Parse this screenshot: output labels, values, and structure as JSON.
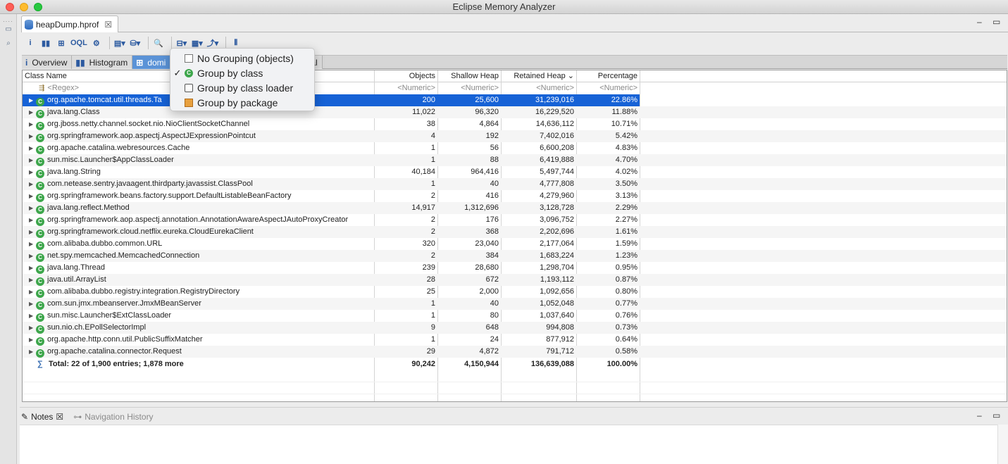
{
  "window": {
    "title": "Eclipse Memory Analyzer"
  },
  "editor_tab": {
    "label": "heapDump.hprof"
  },
  "window_controls": {
    "minimize": "–",
    "maximize": "▭"
  },
  "toolbar": {
    "buttons": [
      {
        "name": "info-icon",
        "glyph": "i"
      },
      {
        "name": "histogram-icon",
        "glyph": "▮▮"
      },
      {
        "name": "dominator-tree-icon",
        "glyph": "⊞"
      },
      {
        "name": "oql-icon",
        "glyph": "OQL"
      },
      {
        "name": "thread-overview-icon",
        "glyph": "⚙"
      },
      {
        "name": "run-report-icon",
        "glyph": "▤▾"
      },
      {
        "name": "query-browser-icon",
        "glyph": "⛁▾"
      },
      {
        "name": "search-icon",
        "glyph": "🔍"
      },
      {
        "name": "group-by-icon",
        "glyph": "⊟▾"
      },
      {
        "name": "calculator-icon",
        "glyph": "▦▾"
      },
      {
        "name": "export-icon",
        "glyph": "⤴▾"
      },
      {
        "name": "compare-icon",
        "glyph": "⫴"
      }
    ]
  },
  "subtabs": [
    {
      "label": "Overview",
      "icon": "i"
    },
    {
      "label": "Histogram",
      "icon": "▮▮"
    },
    {
      "label": "domi",
      "icon": "⊞"
    },
    {
      "label": "al",
      "icon": ""
    }
  ],
  "group_menu": {
    "items": [
      {
        "label": "No Grouping (objects)",
        "checked": "",
        "icon": "file"
      },
      {
        "label": "Group by class",
        "checked": "✓",
        "icon": "class"
      },
      {
        "label": "Group by class loader",
        "checked": "",
        "icon": "loader"
      },
      {
        "label": "Group by package",
        "checked": "",
        "icon": "package"
      }
    ]
  },
  "table": {
    "columns": [
      "Class Name",
      "Objects",
      "Shallow Heap",
      "Retained Heap",
      "Percentage"
    ],
    "sort_indicator": "⌄",
    "filter": {
      "name": "<Regex>",
      "objects": "<Numeric>",
      "shallow": "<Numeric>",
      "retained": "<Numeric>",
      "percentage": "<Numeric>"
    },
    "rows": [
      {
        "name": "org.apache.tomcat.util.threads.Ta",
        "objects": "200",
        "shallow": "25,600",
        "retained": "31,239,016",
        "percentage": "22.86%"
      },
      {
        "name": "java.lang.Class",
        "objects": "11,022",
        "shallow": "96,320",
        "retained": "16,229,520",
        "percentage": "11.88%"
      },
      {
        "name": "org.jboss.netty.channel.socket.nio.NioClientSocketChannel",
        "objects": "38",
        "shallow": "4,864",
        "retained": "14,636,112",
        "percentage": "10.71%"
      },
      {
        "name": "org.springframework.aop.aspectj.AspectJExpressionPointcut",
        "objects": "4",
        "shallow": "192",
        "retained": "7,402,016",
        "percentage": "5.42%"
      },
      {
        "name": "org.apache.catalina.webresources.Cache",
        "objects": "1",
        "shallow": "56",
        "retained": "6,600,208",
        "percentage": "4.83%"
      },
      {
        "name": "sun.misc.Launcher$AppClassLoader",
        "objects": "1",
        "shallow": "88",
        "retained": "6,419,888",
        "percentage": "4.70%"
      },
      {
        "name": "java.lang.String",
        "objects": "40,184",
        "shallow": "964,416",
        "retained": "5,497,744",
        "percentage": "4.02%"
      },
      {
        "name": "com.netease.sentry.javaagent.thirdparty.javassist.ClassPool",
        "objects": "1",
        "shallow": "40",
        "retained": "4,777,808",
        "percentage": "3.50%"
      },
      {
        "name": "org.springframework.beans.factory.support.DefaultListableBeanFactory",
        "objects": "2",
        "shallow": "416",
        "retained": "4,279,960",
        "percentage": "3.13%"
      },
      {
        "name": "java.lang.reflect.Method",
        "objects": "14,917",
        "shallow": "1,312,696",
        "retained": "3,128,728",
        "percentage": "2.29%"
      },
      {
        "name": "org.springframework.aop.aspectj.annotation.AnnotationAwareAspectJAutoProxyCreator",
        "objects": "2",
        "shallow": "176",
        "retained": "3,096,752",
        "percentage": "2.27%"
      },
      {
        "name": "org.springframework.cloud.netflix.eureka.CloudEurekaClient",
        "objects": "2",
        "shallow": "368",
        "retained": "2,202,696",
        "percentage": "1.61%"
      },
      {
        "name": "com.alibaba.dubbo.common.URL",
        "objects": "320",
        "shallow": "23,040",
        "retained": "2,177,064",
        "percentage": "1.59%"
      },
      {
        "name": "net.spy.memcached.MemcachedConnection",
        "objects": "2",
        "shallow": "384",
        "retained": "1,683,224",
        "percentage": "1.23%"
      },
      {
        "name": "java.lang.Thread",
        "objects": "239",
        "shallow": "28,680",
        "retained": "1,298,704",
        "percentage": "0.95%"
      },
      {
        "name": "java.util.ArrayList",
        "objects": "28",
        "shallow": "672",
        "retained": "1,193,112",
        "percentage": "0.87%"
      },
      {
        "name": "com.alibaba.dubbo.registry.integration.RegistryDirectory",
        "objects": "25",
        "shallow": "2,000",
        "retained": "1,092,656",
        "percentage": "0.80%"
      },
      {
        "name": "com.sun.jmx.mbeanserver.JmxMBeanServer",
        "objects": "1",
        "shallow": "40",
        "retained": "1,052,048",
        "percentage": "0.77%"
      },
      {
        "name": "sun.misc.Launcher$ExtClassLoader",
        "objects": "1",
        "shallow": "80",
        "retained": "1,037,640",
        "percentage": "0.76%"
      },
      {
        "name": "sun.nio.ch.EPollSelectorImpl",
        "objects": "9",
        "shallow": "648",
        "retained": "994,808",
        "percentage": "0.73%"
      },
      {
        "name": "org.apache.http.conn.util.PublicSuffixMatcher",
        "objects": "1",
        "shallow": "24",
        "retained": "877,912",
        "percentage": "0.64%"
      },
      {
        "name": "org.apache.catalina.connector.Request",
        "objects": "29",
        "shallow": "4,872",
        "retained": "791,712",
        "percentage": "0.58%"
      }
    ],
    "total": {
      "name": "Total: 22 of 1,900 entries; 1,878 more",
      "objects": "90,242",
      "shallow": "4,150,944",
      "retained": "136,639,088",
      "percentage": "100.00%"
    }
  },
  "bottom_panel": {
    "tabs": [
      {
        "label": "Notes",
        "active": true
      },
      {
        "label": "Navigation History",
        "active": false
      }
    ]
  }
}
